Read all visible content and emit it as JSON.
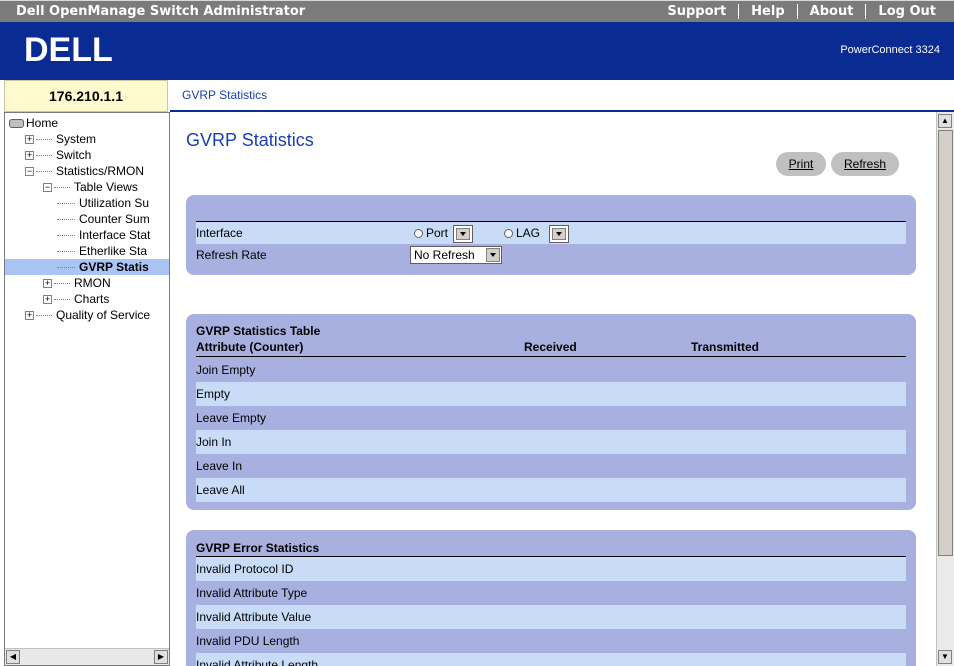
{
  "app": {
    "title": "Dell OpenManage Switch Administrator",
    "nav": [
      "Support",
      "Help",
      "About",
      "Log Out"
    ],
    "logo_text": "DELL",
    "model": "PowerConnect 3324",
    "ip": "176.210.1.1",
    "breadcrumb": "GVRP Statistics"
  },
  "tree": [
    {
      "label": "Home",
      "level": 0,
      "kind": "root"
    },
    {
      "label": "System",
      "level": 1,
      "kind": "plus"
    },
    {
      "label": "Switch",
      "level": 1,
      "kind": "plus"
    },
    {
      "label": "Statistics/RMON",
      "level": 1,
      "kind": "minus"
    },
    {
      "label": "Table Views",
      "level": 2,
      "kind": "minus"
    },
    {
      "label": "Utilization Su",
      "level": 3,
      "kind": "leaf"
    },
    {
      "label": "Counter Sum",
      "level": 3,
      "kind": "leaf"
    },
    {
      "label": "Interface Stat",
      "level": 3,
      "kind": "leaf"
    },
    {
      "label": "Etherlike Sta",
      "level": 3,
      "kind": "leaf"
    },
    {
      "label": "GVRP Statis",
      "level": 3,
      "kind": "leaf",
      "selected": true
    },
    {
      "label": "RMON",
      "level": 2,
      "kind": "plus"
    },
    {
      "label": "Charts",
      "level": 2,
      "kind": "plus"
    },
    {
      "label": "Quality of Service",
      "level": 1,
      "kind": "plus"
    }
  ],
  "page": {
    "title": "GVRP Statistics",
    "print_label": "Print",
    "refresh_label": "Refresh"
  },
  "form": {
    "interface_label": "Interface",
    "port_label": "Port",
    "lag_label": "LAG",
    "refresh_rate_label": "Refresh Rate",
    "refresh_rate_value": "No Refresh"
  },
  "stats_table": {
    "title": "GVRP Statistics Table",
    "headers": [
      "Attribute (Counter)",
      "Received",
      "Transmitted"
    ],
    "rows": [
      "Join Empty",
      "Empty",
      "Leave Empty",
      "Join In",
      "Leave In",
      "Leave All"
    ]
  },
  "error_table": {
    "title": "GVRP Error Statistics",
    "rows": [
      "Invalid Protocol ID",
      "Invalid Attribute Type",
      "Invalid Attribute Value",
      "Invalid PDU Length",
      "Invalid Attribute Length"
    ]
  },
  "colors": {
    "banner": "#0a2b92",
    "panel": "#a8b0e0",
    "row_alt": "#c8dcf8",
    "selected": "#a9c4f5",
    "title_blue": "#1a3fb5"
  }
}
